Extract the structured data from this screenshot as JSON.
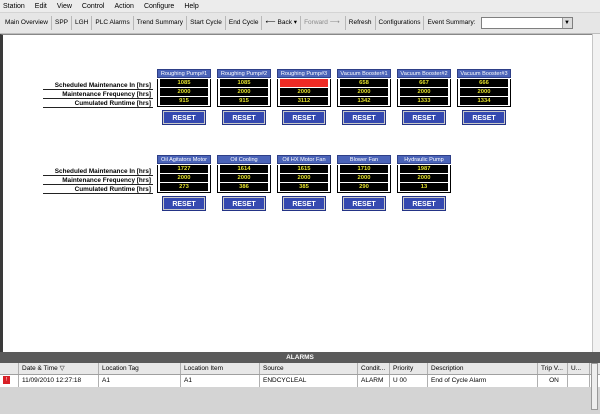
{
  "menu": [
    "Station",
    "Edit",
    "View",
    "Control",
    "Action",
    "Configure",
    "Help"
  ],
  "toolbar": {
    "items": [
      "Main Overview",
      "SPP",
      "LGH",
      "PLC Alarms",
      "Trend Summary",
      "Start Cycle",
      "End Cycle"
    ],
    "back": "Back",
    "forward": "Forward",
    "refresh": "Refresh",
    "configurations": "Configurations",
    "event_summary": "Event Summary:",
    "event_value": ""
  },
  "panel1": {
    "labels": [
      "Scheduled Maintenance In [hrs]",
      "Maintenance Frequency [hrs]",
      "Cumulated Runtime [hrs]"
    ],
    "columns": [
      {
        "name": "Roughing Pump#1",
        "values": [
          "1085",
          "2000",
          "915"
        ],
        "reset": "RESET"
      },
      {
        "name": "Roughing Pump#2",
        "values": [
          "1085",
          "2000",
          "915"
        ],
        "reset": "RESET"
      },
      {
        "name": "Roughing Pump#3",
        "values": [
          "-1112",
          "2000",
          "3112"
        ],
        "reset": "RESET"
      },
      {
        "name": "Vacuum Booster#1",
        "values": [
          "658",
          "2000",
          "1342"
        ],
        "reset": "RESET"
      },
      {
        "name": "Vacuum Booster#2",
        "values": [
          "667",
          "2000",
          "1333"
        ],
        "reset": "RESET"
      },
      {
        "name": "Vacuum Booster#3",
        "values": [
          "666",
          "2000",
          "1334"
        ],
        "reset": "RESET"
      }
    ]
  },
  "panel2": {
    "labels": [
      "Scheduled Maintenance In [hrs]",
      "Maintenance Frequency [hrs]",
      "Cumulated Runtime [hrs]"
    ],
    "columns": [
      {
        "name": "Oil Agitators Motor",
        "values": [
          "1727",
          "2000",
          "273"
        ],
        "reset": "RESET"
      },
      {
        "name": "Oil Cooling",
        "values": [
          "1614",
          "2000",
          "386"
        ],
        "reset": "RESET"
      },
      {
        "name": "Oil HX Motor Fan",
        "values": [
          "1615",
          "2000",
          "385"
        ],
        "reset": "RESET"
      },
      {
        "name": "Blower Fan",
        "values": [
          "1710",
          "2000",
          "290"
        ],
        "reset": "RESET"
      },
      {
        "name": "Hydraulic Pump",
        "values": [
          "1987",
          "2000",
          "13"
        ],
        "reset": "RESET"
      }
    ]
  },
  "alarms": {
    "title": "ALARMS",
    "columns": [
      "Date & Time",
      "Location Tag",
      "Location Item",
      "Source",
      "Condit...",
      "Priority",
      "Description",
      "Trip V...",
      "U..."
    ],
    "rows": [
      [
        "11/09/2010 12:27:18",
        "A1",
        "A1",
        "ENDCYCLEAL",
        "ALARM",
        "U 00",
        "End of Cycle Alarm",
        "ON",
        ""
      ]
    ]
  },
  "colors": {
    "header_blue": "#4a63b8",
    "reset_blue": "#3549b0",
    "value_yellow": "#e4e12c",
    "alarm_red": "#ee2b24"
  }
}
